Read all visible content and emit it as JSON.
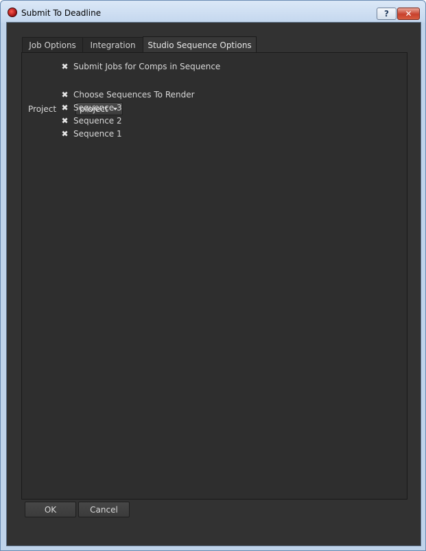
{
  "window": {
    "title": "Submit To Deadline",
    "help_label": "?",
    "close_label": "✕"
  },
  "tabs": [
    {
      "label": "Job Options"
    },
    {
      "label": "Integration"
    },
    {
      "label": "Studio Sequence Options",
      "active": true
    }
  ],
  "panel": {
    "submit_jobs_label": "Submit Jobs for Comps in Sequence",
    "submit_jobs_checked": true,
    "project_label": "Project",
    "project_value": "project",
    "choose_sequences_label": "Choose Sequences To Render",
    "choose_sequences_checked": true,
    "sequences": [
      {
        "label": "Sequence 3",
        "checked": true
      },
      {
        "label": "Sequence 2",
        "checked": true
      },
      {
        "label": "Sequence 1",
        "checked": true
      }
    ],
    "check_glyph": "✖"
  },
  "buttons": {
    "ok_label": "OK",
    "cancel_label": "Cancel"
  },
  "icons": {
    "app": "app-logo-icon",
    "checkbox_checked": "x-mark-icon",
    "dropdown": "chevron-down-icon"
  }
}
